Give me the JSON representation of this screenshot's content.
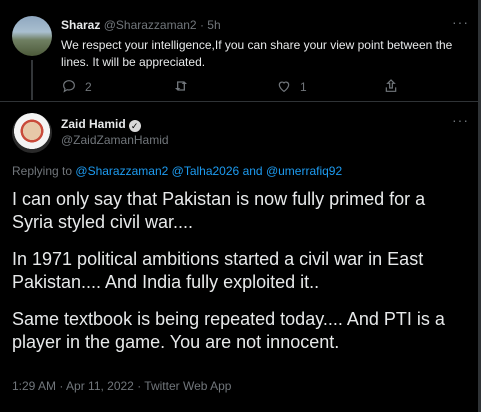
{
  "tweet1": {
    "display_name": "Sharaz",
    "handle": "@Sharazzaman2",
    "separator": "·",
    "time": "5h",
    "text": "We respect your intelligence,If you can share your view point between the lines. It will be appreciated.",
    "reply_count": "2",
    "like_count": "1"
  },
  "tweet2": {
    "display_name": "Zaid Hamid",
    "verified_glyph": "✓",
    "handle": "@ZaidZamanHamid",
    "replying_to_label": "Replying to",
    "replying_to_1": "@Sharazzaman2",
    "replying_to_2": "@Talha2026",
    "replying_to_and": "and",
    "replying_to_3": "@umerrafiq92",
    "paragraphs": [
      "I can only say that Pakistan is now fully primed for a Syria styled civil war....",
      "In 1971 political ambitions started a civil war in East Pakistan.... And India fully exploited it..",
      "Same textbook is being repeated today.... And PTI is a player in the game. You are not innocent."
    ],
    "timestamp": "1:29 AM · Apr 11, 2022 · Twitter Web App"
  },
  "icons": {
    "more": "more-icon",
    "reply": "reply-icon",
    "retweet": "retweet-icon",
    "like": "like-icon",
    "share": "share-icon",
    "verified": "verified-badge-icon"
  },
  "colors": {
    "background": "#000000",
    "text": "#e7e9ea",
    "muted": "#71767b",
    "link": "#1d9bf0"
  }
}
